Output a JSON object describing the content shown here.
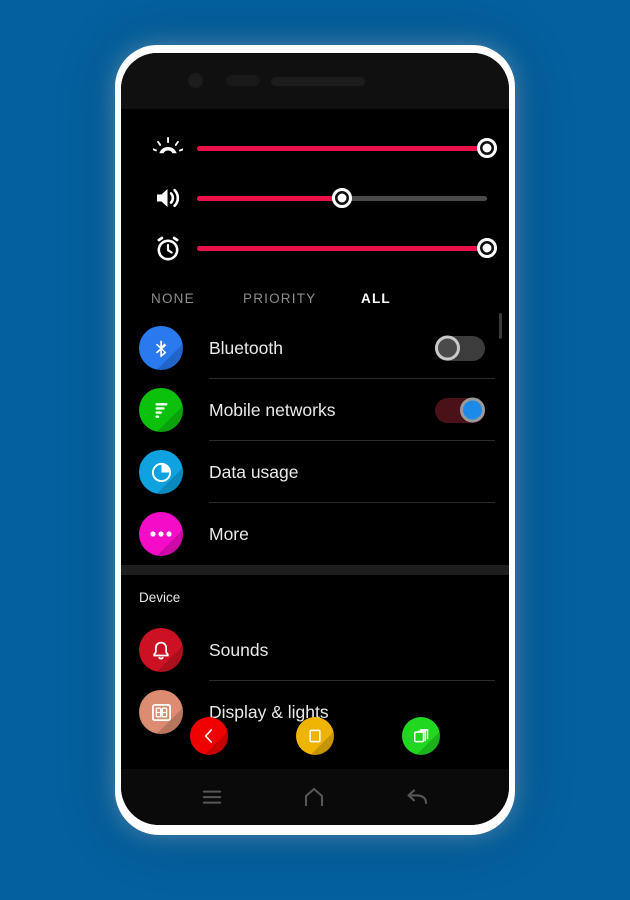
{
  "background": {
    "color": "#04609F"
  },
  "device": {
    "bezel_color": "#FFFFFF",
    "camera": "front-camera",
    "sensor": "proximity-sensor",
    "speaker": "earpiece-speaker"
  },
  "quick_settings": {
    "sliders": [
      {
        "name": "brightness",
        "icon": "brightness-icon",
        "value": 100,
        "fill_color": "#EA1048",
        "track_color": "#4A4A4A"
      },
      {
        "name": "volume",
        "icon": "volume-icon",
        "value": 50,
        "fill_color": "#EA1048",
        "track_color": "#4A4A4A"
      },
      {
        "name": "alarm",
        "icon": "alarm-clock-icon",
        "value": 100,
        "fill_color": "#EA1048",
        "track_color": "#4A4A4A"
      }
    ]
  },
  "tabs": [
    {
      "label": "NONE",
      "selected": false
    },
    {
      "label": "PRIORITY",
      "selected": false
    },
    {
      "label": "ALL",
      "selected": true
    }
  ],
  "settings_list": [
    {
      "label": "Bluetooth",
      "icon": "bluetooth-icon",
      "icon_color": "#2979EF",
      "control": "toggle",
      "toggle_state": "off"
    },
    {
      "label": "Mobile networks",
      "icon": "signal-bars-icon",
      "icon_color": "#0CC10C",
      "control": "toggle",
      "toggle_state": "on"
    },
    {
      "label": "Data usage",
      "icon": "pie-chart-icon",
      "icon_color": "#0EA2E0",
      "control": "none"
    },
    {
      "label": "More",
      "icon": "more-dots-icon",
      "icon_color": "#F50CC8",
      "control": "none"
    }
  ],
  "device_section": {
    "header": "Device",
    "items": [
      {
        "label": "Sounds",
        "icon": "bell-icon",
        "icon_color": "#CC1122"
      },
      {
        "label": "Display & lights",
        "icon": "display-88-icon",
        "icon_color": "#DC8C70"
      }
    ]
  },
  "floating_buttons": [
    {
      "name": "back-button",
      "icon": "chevron-left-icon",
      "color": "#F00000"
    },
    {
      "name": "home-button",
      "icon": "square-icon",
      "color": "#EFB401"
    },
    {
      "name": "recents-button",
      "icon": "stacked-squares-icon",
      "color": "#21D821"
    }
  ],
  "nav_bar": [
    {
      "name": "menu-button",
      "icon": "hamburger-icon"
    },
    {
      "name": "home-button",
      "icon": "home-icon"
    },
    {
      "name": "back-button",
      "icon": "back-arrow-icon"
    }
  ]
}
